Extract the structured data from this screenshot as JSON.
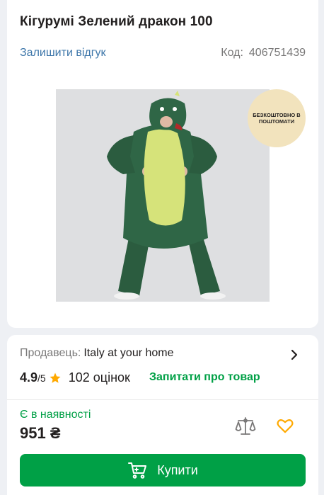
{
  "product": {
    "title": "Кігурумі Зелений дракон 100",
    "review_link": "Залишити відгук",
    "code_label": "Код:",
    "code_value": "406751439",
    "badge_text": "БЕЗКОШТОВНО В ПОШТОМАТИ",
    "image_alt": "kigurumi-green-dragon-photo"
  },
  "seller": {
    "label": "Продавець:",
    "name": "Italy at your home"
  },
  "rating": {
    "score": "4.9",
    "out_of": "/5",
    "count": "102 оцінок",
    "ask_link": "Запитати про товар"
  },
  "purchase": {
    "availability": "Є в наявності",
    "price": "951 ₴",
    "buy_label": "Купити"
  },
  "colors": {
    "green": "#00a046",
    "link_blue": "#3e77aa",
    "star": "#ffa900",
    "heart": "#ffa900",
    "badge_bg": "#f2e3bd"
  },
  "icons": [
    "compare-scales-icon",
    "heart-icon",
    "cart-icon",
    "chevron-right-icon",
    "star-icon"
  ]
}
